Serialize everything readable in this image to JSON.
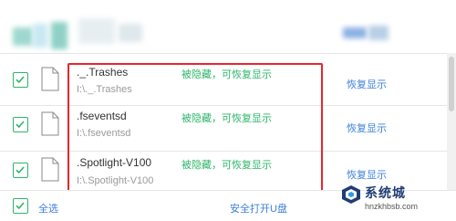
{
  "files": [
    {
      "name": "._.Trashes",
      "path": "I:\\._.Trashes",
      "status": "被隐藏，可恢复显示",
      "action": "恢复显示",
      "checked": true
    },
    {
      "name": ".fseventsd",
      "path": "I:\\.fseventsd",
      "status": "被隐藏，可恢复显示",
      "action": "恢复显示",
      "checked": true
    },
    {
      "name": ".Spotlight-V100",
      "path": "I:\\.Spotlight-V100",
      "status": "被隐藏，可恢复显示",
      "action": "恢复显示",
      "checked": true
    }
  ],
  "footer": {
    "select_all_label": "全选",
    "open_drive_label": "安全打开U盘"
  },
  "watermark": {
    "title": "系统城",
    "url": "hnzkhbsb.com"
  },
  "colors": {
    "checkbox_green": "#2db56a",
    "status_green": "#2db56a",
    "link_blue": "#3d7fd9",
    "highlight_red": "#e8262b"
  }
}
